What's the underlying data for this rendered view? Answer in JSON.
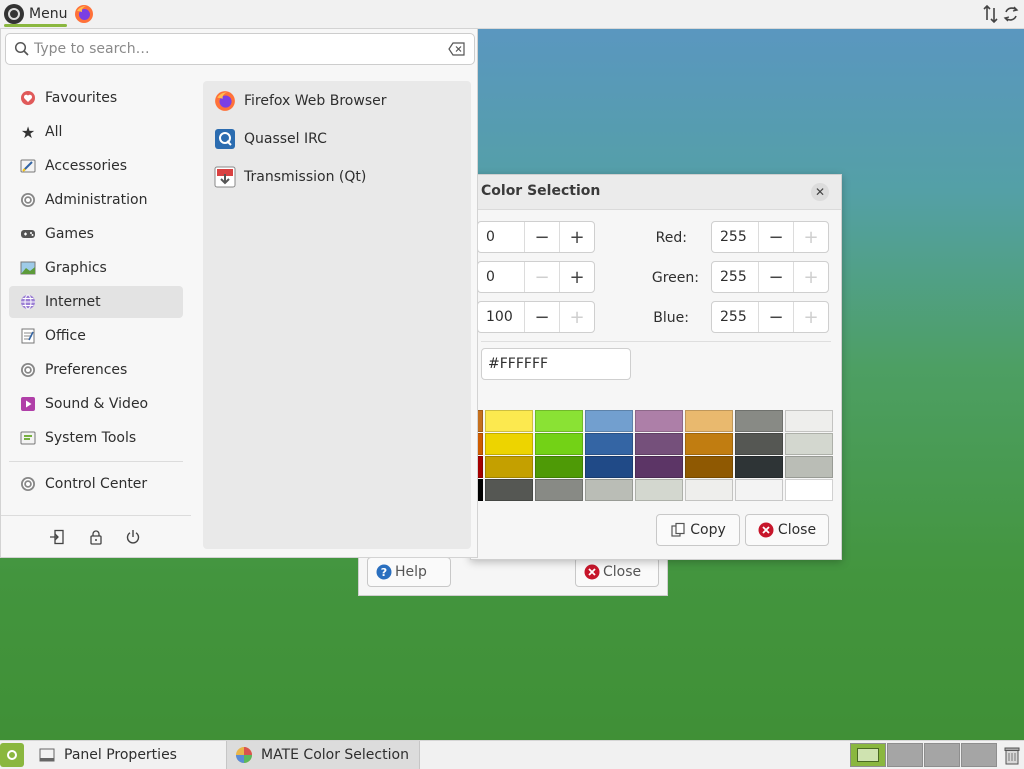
{
  "top_panel": {
    "menu_label": "Menu",
    "launcher_icon": "firefox-icon"
  },
  "search": {
    "placeholder": "Type to search…"
  },
  "categories": [
    {
      "label": "Favourites",
      "icon": "heart-icon"
    },
    {
      "label": "All",
      "icon": "star-icon"
    },
    {
      "label": "Accessories",
      "icon": "accessories-icon"
    },
    {
      "label": "Administration",
      "icon": "administration-icon"
    },
    {
      "label": "Games",
      "icon": "gamepad-icon"
    },
    {
      "label": "Graphics",
      "icon": "image-icon"
    },
    {
      "label": "Internet",
      "icon": "globe-icon",
      "selected": true
    },
    {
      "label": "Office",
      "icon": "office-icon"
    },
    {
      "label": "Preferences",
      "icon": "preferences-icon"
    },
    {
      "label": "Sound & Video",
      "icon": "play-icon"
    },
    {
      "label": "System Tools",
      "icon": "system-tools-icon"
    },
    {
      "label": "Control Center",
      "icon": "control-center-icon"
    }
  ],
  "apps": [
    {
      "label": "Firefox Web Browser",
      "icon": "firefox-icon"
    },
    {
      "label": "Quassel IRC",
      "icon": "quassel-icon"
    },
    {
      "label": "Transmission (Qt)",
      "icon": "transmission-icon"
    }
  ],
  "session_buttons": [
    "logout-icon",
    "lock-icon",
    "power-icon"
  ],
  "color_dialog": {
    "title": "Color Selection",
    "hsv": [
      "0",
      "0",
      "100"
    ],
    "rgb": [
      {
        "label": "Red:",
        "value": "255"
      },
      {
        "label": "Green:",
        "value": "255"
      },
      {
        "label": "Blue:",
        "value": "255"
      }
    ],
    "hex": "#FFFFFF",
    "copy_label": "Copy",
    "close_label": "Close",
    "palette": [
      [
        "#c5701e",
        "#fce94f",
        "#8ae234",
        "#729fcf",
        "#ad7fa8",
        "#e9b96e",
        "#888a85",
        "#eeeeec"
      ],
      [
        "#ce5c00",
        "#edd400",
        "#73d216",
        "#3465a4",
        "#75507b",
        "#c17d11",
        "#555753",
        "#d3d7cf"
      ],
      [
        "#a40000",
        "#c4a000",
        "#4e9a06",
        "#204a87",
        "#5c3566",
        "#8f5902",
        "#2e3436",
        "#babdb6"
      ],
      [
        "#000000",
        "#555753",
        "#888a85",
        "#babdb6",
        "#d3d7cf",
        "#eeeeec",
        "#f3f3f3",
        "#ffffff"
      ]
    ]
  },
  "panel_props_dialog": {
    "help_label": "Help",
    "close_label": "Close"
  },
  "taskbar": [
    {
      "label": "Panel Properties",
      "icon": "panel-icon"
    },
    {
      "label": "MATE Color Selection",
      "icon": "color-wheel-icon",
      "active": true
    }
  ],
  "colors": {
    "accent": "#8ab73f",
    "panel_bg": "#f1f1f1",
    "close_red": "#c7162b",
    "help_blue": "#2a6fbf"
  }
}
